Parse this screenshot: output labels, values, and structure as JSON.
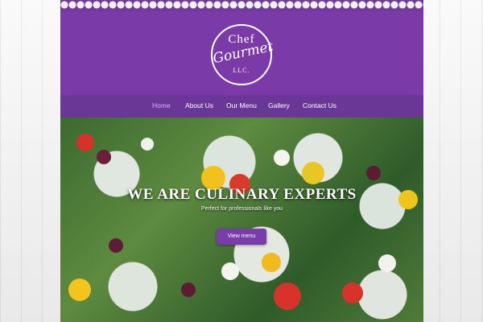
{
  "logo": {
    "line1": "Chef",
    "line2": "Gourmet",
    "line3": "LLC."
  },
  "nav": {
    "items": [
      {
        "label": "Home",
        "active": true
      },
      {
        "label": "About Us",
        "active": false
      },
      {
        "label": "Our Menu",
        "active": false
      },
      {
        "label": "Gallery",
        "active": false
      },
      {
        "label": "Contact Us",
        "active": false
      }
    ]
  },
  "hero": {
    "title": "WE ARE CULINARY EXPERTS",
    "subtitle": "Perfect for professionals like you",
    "button_label": "View menu"
  },
  "colors": {
    "brand_purple": "#7a3aa8",
    "nav_purple": "#6b3796",
    "active_nav": "#d9b6ff"
  }
}
